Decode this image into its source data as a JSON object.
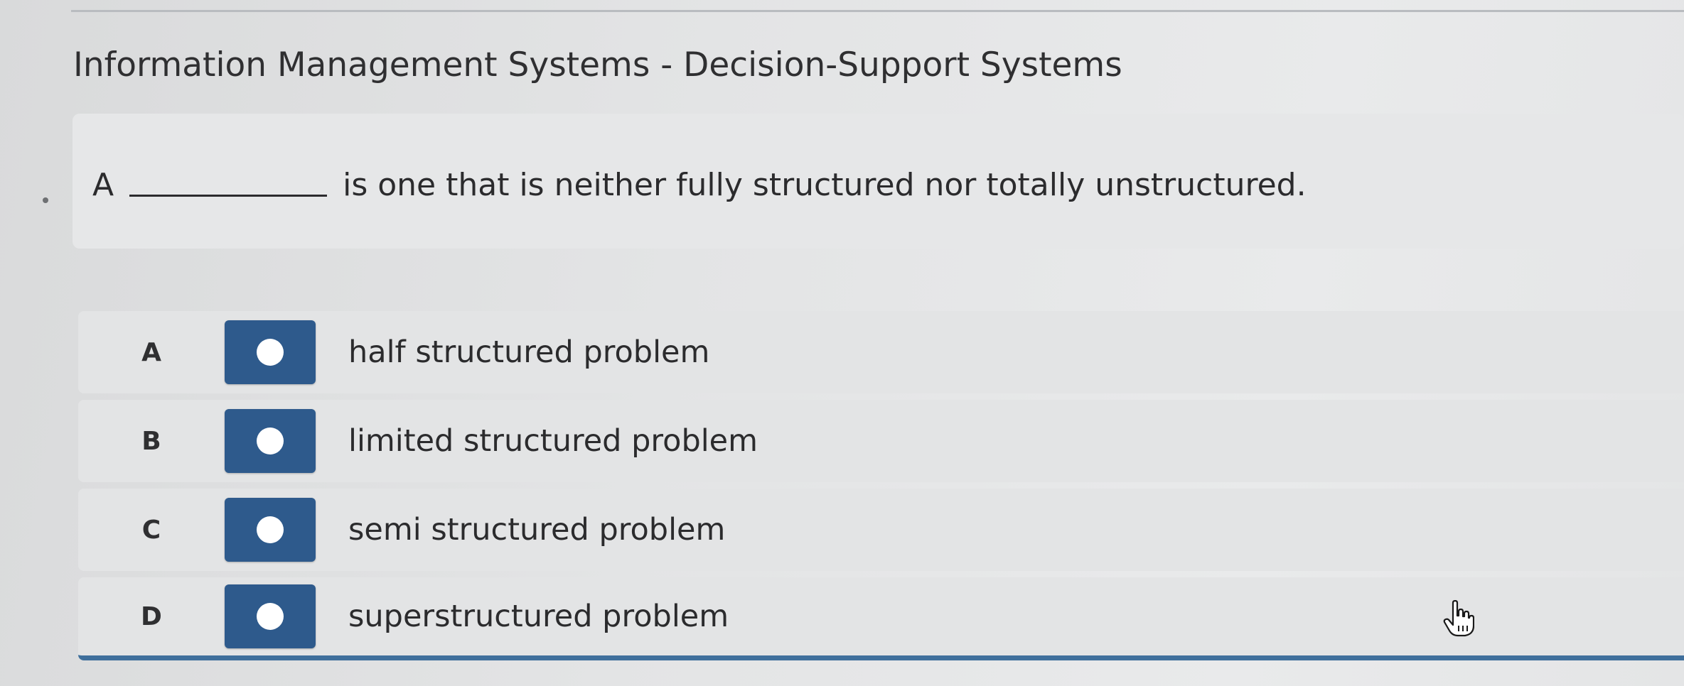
{
  "header": {
    "category": "Information Management Systems - Decision-Support Systems"
  },
  "question": {
    "prefix": "A",
    "suffix": "is one that is neither fully structured nor totally unstructured."
  },
  "options": [
    {
      "letter": "A",
      "text": "half structured problem"
    },
    {
      "letter": "B",
      "text": "limited structured problem"
    },
    {
      "letter": "C",
      "text": "semi structured problem"
    },
    {
      "letter": "D",
      "text": "superstructured problem"
    }
  ],
  "colors": {
    "radio_button": "#2e5a8c",
    "accent_line": "#3f6f9c"
  },
  "icons": {
    "cursor": "hand-pointer-icon",
    "radio": "radio-dot-icon"
  }
}
